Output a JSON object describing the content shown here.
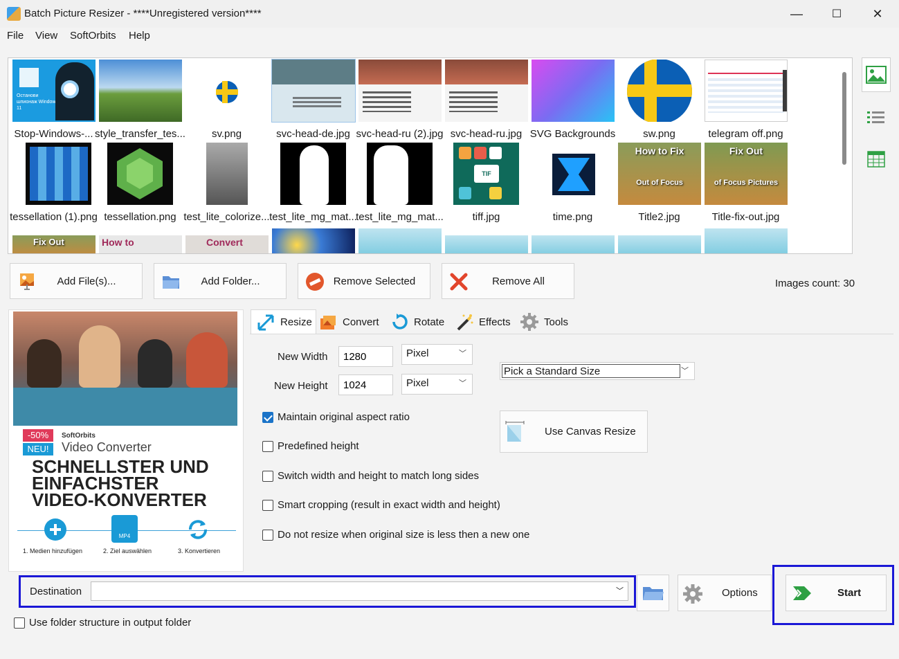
{
  "window": {
    "title": "Batch Picture Resizer - ****Unregistered version****",
    "minimize": "—",
    "maximize": "☐",
    "close": "✕"
  },
  "menu": [
    "File",
    "View",
    "SoftOrbits",
    "Help"
  ],
  "thumbnails": [
    {
      "label": "Stop-Windows-...",
      "icon": "windows-spy-thumbnail"
    },
    {
      "label": "style_transfer_tes...",
      "icon": "landscape-thumbnail"
    },
    {
      "label": "sv.png",
      "icon": "sweden-flag-small-thumbnail"
    },
    {
      "label": "svc-head-de.jpg",
      "icon": "video-converter-de-thumbnail"
    },
    {
      "label": "svc-head-ru (2).jpg",
      "icon": "video-converter-ru-thumbnail"
    },
    {
      "label": "svc-head-ru.jpg",
      "icon": "video-converter-ru-thumbnail"
    },
    {
      "label": "SVG Backgrounds Background coll...",
      "icon": "gradient-background-thumbnail"
    },
    {
      "label": "sw.png",
      "icon": "sweden-flag-thumbnail"
    },
    {
      "label": "telegram off.png",
      "icon": "screenshot-thumbnail"
    },
    {
      "label": "tessellation (1).png",
      "icon": "puzzle-thumbnail"
    },
    {
      "label": "tessellation.png",
      "icon": "hexagons-thumbnail"
    },
    {
      "label": "test_lite_colorize...",
      "icon": "bw-photo-thumbnail"
    },
    {
      "label": "test_lite_mg_mat...",
      "icon": "silhouette-thumbnail"
    },
    {
      "label": "test_lite_mg_mat...",
      "icon": "silhouette-thumbnail"
    },
    {
      "label": "tiff.jpg",
      "icon": "tiff-icons-thumbnail"
    },
    {
      "label": "time.png",
      "icon": "time-logo-thumbnail"
    },
    {
      "label": "Title2.jpg",
      "icon": "how-to-fix-thumbnail"
    },
    {
      "label": "Title-fix-out.jpg",
      "icon": "fix-out-thumbnail"
    }
  ],
  "thumbnail_texts": {
    "win_spy": "Останови шпионаж Windows 11",
    "how_to_fix": "How to Fix",
    "out_of_focus": "Out of Focus",
    "fix_out": "Fix Out",
    "of_focus_pictures": "of Focus Pictures",
    "tif": "TIF",
    "how_to": "How to",
    "convert": "Convert"
  },
  "actions": {
    "add_files": "Add File(s)...",
    "add_folder": "Add Folder...",
    "remove_selected": "Remove Selected",
    "remove_all": "Remove All",
    "images_count": "Images count: 30"
  },
  "promo": {
    "badge_discount": "-50%",
    "badge_new": "NEU!",
    "brand": "SoftOrbits",
    "product": "Video Converter",
    "headline_1": "SCHNELLSTER UND",
    "headline_2": "EINFACHSTER",
    "headline_3": "VIDEO-KONVERTER",
    "step1": "1. Medien hinzufügen",
    "step2": "2. Ziel auswählen",
    "step3": "3. Konvertieren",
    "mp4": "MP4"
  },
  "tabs": [
    "Resize",
    "Convert",
    "Rotate",
    "Effects",
    "Tools"
  ],
  "resize": {
    "new_width_label": "New Width",
    "new_width_value": "1280",
    "new_height_label": "New Height",
    "new_height_value": "1024",
    "width_unit": "Pixel",
    "height_unit": "Pixel",
    "standard_size": "Pick a Standard Size",
    "use_canvas_resize": "Use Canvas Resize",
    "options": [
      {
        "label": "Maintain original aspect ratio",
        "checked": true
      },
      {
        "label": "Predefined height",
        "checked": false
      },
      {
        "label": "Switch width and height to match long sides",
        "checked": false
      },
      {
        "label": "Smart cropping (result in exact width and height)",
        "checked": false
      },
      {
        "label": "Do not resize when original size is less then a new one",
        "checked": false
      }
    ]
  },
  "bottom": {
    "destination_label": "Destination",
    "destination_value": "",
    "options_label": "Options",
    "start_label": "Start",
    "use_folder_structure": "Use folder structure in output folder"
  },
  "colors": {
    "highlight": "#1a17d6",
    "accent_green": "#2ea043",
    "checkbox_blue": "#1a73c8"
  }
}
